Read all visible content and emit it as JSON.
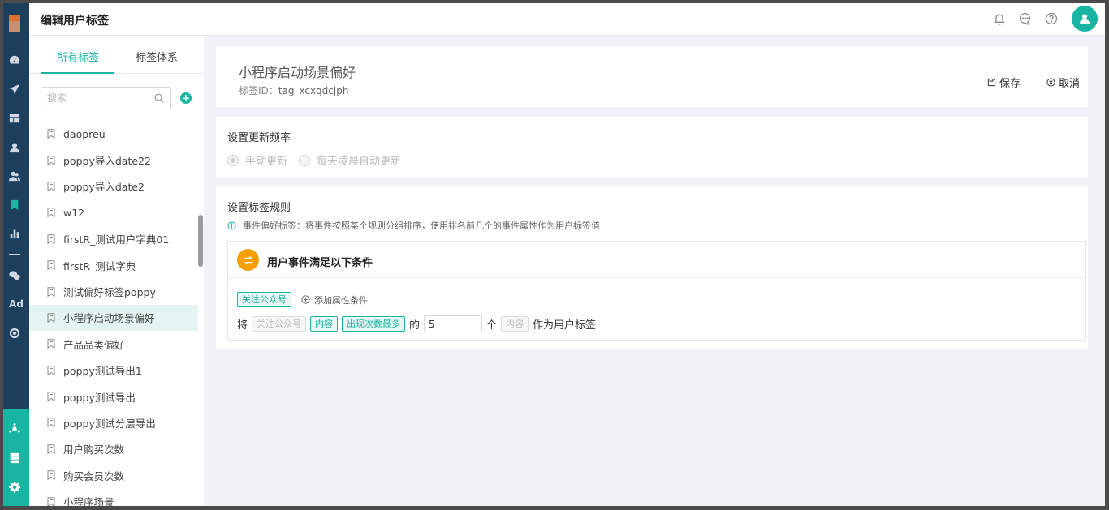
{
  "header": {
    "title": "编辑用户标签"
  },
  "tabs": [
    {
      "label": "所有标签"
    },
    {
      "label": "标签体系"
    }
  ],
  "search": {
    "placeholder": "搜索"
  },
  "rail": {
    "ad_label": "Ad"
  },
  "tag_list": [
    "daopreu",
    "poppy导入date22",
    "poppy导入date2",
    "w12",
    "firstR_测试用户字典01",
    "firstR_测试字典",
    "测试偏好标签poppy",
    "小程序启动场景偏好",
    "产品品类偏好",
    "poppy测试导出1",
    "poppy测试导出",
    "poppy测试分层导出",
    "用户购买次数",
    "购买会员次数",
    "小程序场景"
  ],
  "selected_index": 7,
  "tag": {
    "name": "小程序启动场景偏好",
    "id_label": "标签ID：",
    "id_value": "tag_xcxqdcjph"
  },
  "actions": {
    "save": "保存",
    "cancel": "取消"
  },
  "frequency": {
    "title": "设置更新频率",
    "manual": "手动更新",
    "daily": "每天凌晨自动更新"
  },
  "rules": {
    "title": "设置标签规则",
    "hint": "事件偏好标签：将事件按照某个规则分组排序，使用排名前几个的事件属性作为用户标签值",
    "condition_title": "用户事件满足以下条件",
    "event_chip": "关注公众号",
    "add_condition": "添加属性条件",
    "sentence": {
      "prefix": "将",
      "event": "关注公众号",
      "attr": "内容",
      "order": "出现次数最多",
      "of": "的",
      "count": "5",
      "unit": "个",
      "value": "内容",
      "suffix": "作为用户标签"
    }
  },
  "colors": {
    "accent": "#19b5a3",
    "rail": "#1d3f5e",
    "badge": "#f5a000"
  }
}
